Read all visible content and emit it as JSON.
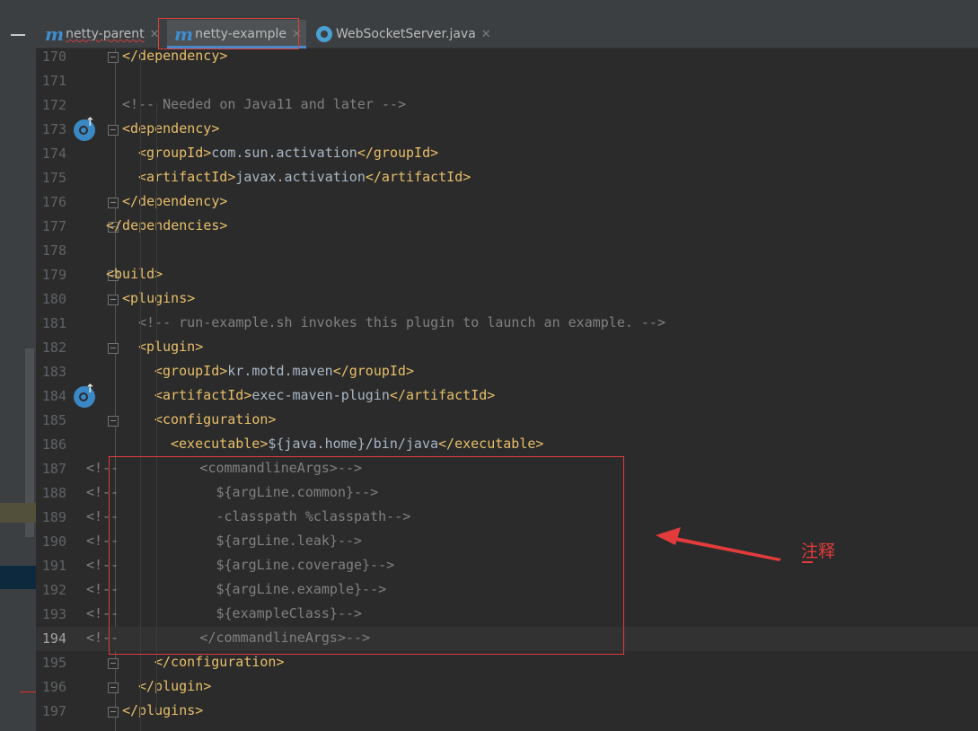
{
  "tabs": [
    {
      "label": "netty-parent",
      "icon": "maven-icon",
      "active": false
    },
    {
      "label": "netty-example",
      "icon": "maven-icon",
      "active": true
    },
    {
      "label": "WebSocketServer.java",
      "icon": "java-class-icon",
      "active": false
    }
  ],
  "editor": {
    "current_line": 194,
    "lines": [
      {
        "num": "170",
        "parts": [
          {
            "t": "</dependency>",
            "c": "tag"
          }
        ]
      },
      {
        "num": "171",
        "parts": []
      },
      {
        "num": "172",
        "parts": [
          {
            "t": "<!-- Needed on Java11 and later -->",
            "c": "cmt"
          }
        ]
      },
      {
        "num": "173",
        "parts": [
          {
            "t": "<dependency>",
            "c": "tag"
          }
        ]
      },
      {
        "num": "174",
        "parts": [
          {
            "t": "<groupId>",
            "c": "tag"
          },
          {
            "t": "com.sun.activation",
            "c": "txt"
          },
          {
            "t": "</groupId>",
            "c": "tag"
          }
        ]
      },
      {
        "num": "175",
        "parts": [
          {
            "t": "<artifactId>",
            "c": "tag"
          },
          {
            "t": "javax.activation",
            "c": "txt"
          },
          {
            "t": "</artifactId>",
            "c": "tag"
          }
        ]
      },
      {
        "num": "176",
        "parts": [
          {
            "t": "</dependency>",
            "c": "tag"
          }
        ]
      },
      {
        "num": "177",
        "parts": [
          {
            "t": "</dependencies>",
            "c": "tag"
          }
        ]
      },
      {
        "num": "178",
        "parts": []
      },
      {
        "num": "179",
        "parts": [
          {
            "t": "<build>",
            "c": "tag"
          }
        ]
      },
      {
        "num": "180",
        "parts": [
          {
            "t": "<plugins>",
            "c": "tag"
          }
        ]
      },
      {
        "num": "181",
        "parts": [
          {
            "t": "<!-- run-example.sh invokes this plugin to launch an example. -->",
            "c": "cmt"
          }
        ]
      },
      {
        "num": "182",
        "parts": [
          {
            "t": "<plugin>",
            "c": "tag"
          }
        ]
      },
      {
        "num": "183",
        "parts": [
          {
            "t": "<groupId>",
            "c": "tag"
          },
          {
            "t": "kr.motd.maven",
            "c": "txt"
          },
          {
            "t": "</groupId>",
            "c": "tag"
          }
        ]
      },
      {
        "num": "184",
        "parts": [
          {
            "t": "<artifactId>",
            "c": "tag"
          },
          {
            "t": "exec-maven-plugin",
            "c": "txt"
          },
          {
            "t": "</artifactId>",
            "c": "tag"
          }
        ]
      },
      {
        "num": "185",
        "parts": [
          {
            "t": "<configuration>",
            "c": "tag"
          }
        ]
      },
      {
        "num": "186",
        "parts": [
          {
            "t": "<executable>",
            "c": "tag"
          },
          {
            "t": "${java.home}/bin/java",
            "c": "txt"
          },
          {
            "t": "</executable>",
            "c": "tag"
          }
        ]
      },
      {
        "num": "187",
        "parts": [
          {
            "t": "<!--          <commandlineArgs>-->",
            "c": "cmt"
          }
        ]
      },
      {
        "num": "188",
        "parts": [
          {
            "t": "<!--            ${argLine.common}-->",
            "c": "cmt"
          }
        ]
      },
      {
        "num": "189",
        "parts": [
          {
            "t": "<!--            -classpath %classpath-->",
            "c": "cmt"
          }
        ]
      },
      {
        "num": "190",
        "parts": [
          {
            "t": "<!--            ${argLine.leak}-->",
            "c": "cmt"
          }
        ]
      },
      {
        "num": "191",
        "parts": [
          {
            "t": "<!--            ${argLine.coverage}-->",
            "c": "cmt"
          }
        ]
      },
      {
        "num": "192",
        "parts": [
          {
            "t": "<!--            ${argLine.example}-->",
            "c": "cmt"
          }
        ]
      },
      {
        "num": "193",
        "parts": [
          {
            "t": "<!--            ${exampleClass}-->",
            "c": "cmt"
          }
        ]
      },
      {
        "num": "194",
        "parts": [
          {
            "t": "<!--          </commandlineArgs>-->",
            "c": "cmt"
          }
        ]
      },
      {
        "num": "195",
        "parts": [
          {
            "t": "</configuration>",
            "c": "tag"
          }
        ]
      },
      {
        "num": "196",
        "parts": [
          {
            "t": "</plugin>",
            "c": "tag"
          }
        ]
      },
      {
        "num": "197",
        "parts": [
          {
            "t": "</plugins>",
            "c": "tag"
          }
        ]
      }
    ]
  },
  "annotation": {
    "text": "注释",
    "color": "#e23b3b"
  },
  "colors": {
    "tag": "#e8bf6a",
    "text": "#a9b7c6",
    "comment": "#808080",
    "background": "#2b2b2b"
  }
}
